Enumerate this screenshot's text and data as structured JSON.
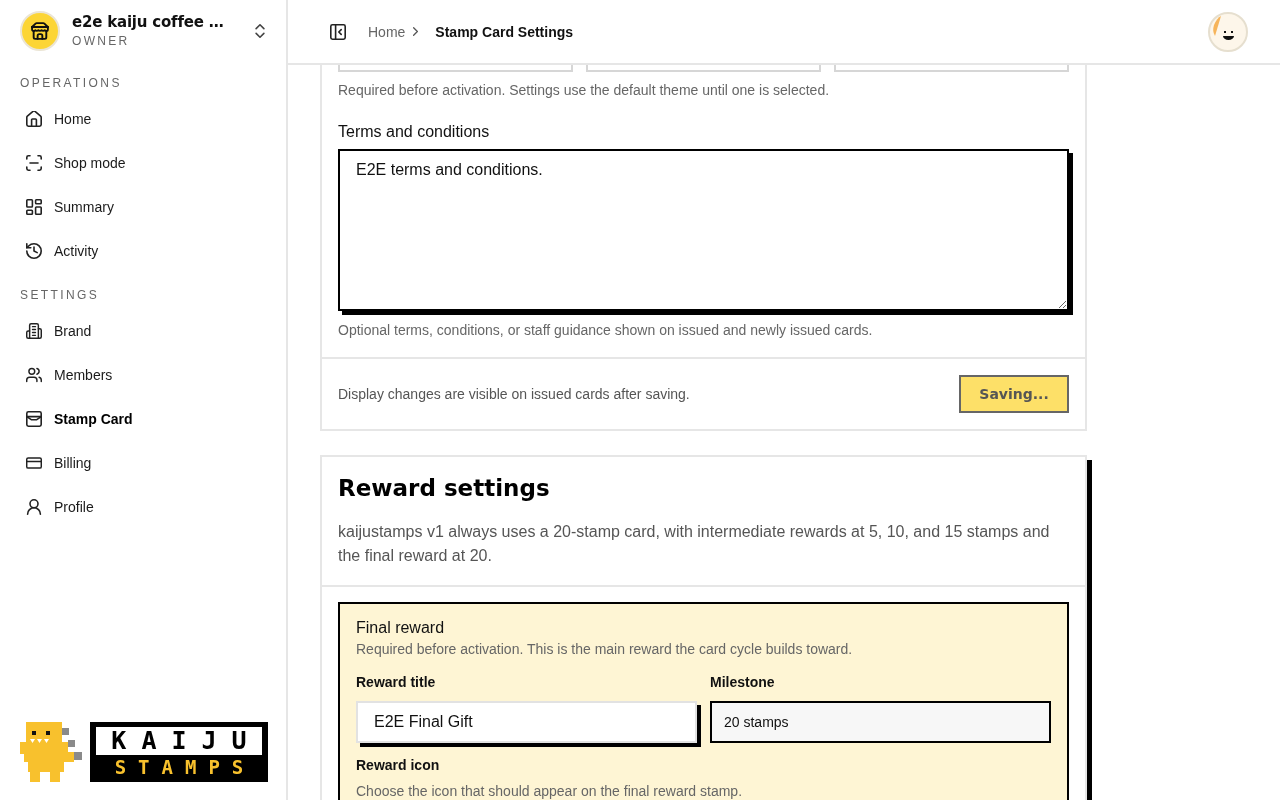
{
  "workspace": {
    "name": "e2e kaiju coffee …",
    "role": "OWNER"
  },
  "sidebar": {
    "sections": [
      {
        "title": "OPERATIONS",
        "items": [
          {
            "label": "Home",
            "selected": false
          },
          {
            "label": "Shop mode",
            "selected": false
          },
          {
            "label": "Summary",
            "selected": false
          },
          {
            "label": "Activity",
            "selected": false
          }
        ]
      },
      {
        "title": "SETTINGS",
        "items": [
          {
            "label": "Brand",
            "selected": false
          },
          {
            "label": "Members",
            "selected": false
          },
          {
            "label": "Stamp Card",
            "selected": true
          },
          {
            "label": "Billing",
            "selected": false
          },
          {
            "label": "Profile",
            "selected": false
          }
        ]
      }
    ],
    "logo": {
      "line_1": "KAIJU",
      "line_2": "STAMPS"
    }
  },
  "header": {
    "breadcrumbs": [
      {
        "label": "Home"
      },
      {
        "label": "Stamp Card Settings"
      }
    ]
  },
  "display_card": {
    "theme_options": [
      {
        "selected": false
      },
      {
        "selected": false
      },
      {
        "selected": false
      }
    ],
    "theme_hint": "Required before activation. Settings use the default theme until one is selected.",
    "terms": {
      "label": "Terms and conditions",
      "value": "E2E terms and conditions.",
      "hint": "Optional terms, conditions, or staff guidance shown on issued and newly issued cards."
    },
    "footer_note": "Display changes are visible on issued cards after saving.",
    "save_button": {
      "label": "Saving...",
      "disabled": true
    }
  },
  "reward_card": {
    "title": "Reward settings",
    "description": "kaijustamps v1 always uses a 20-stamp card, with intermediate rewards at 5, 10, and 15 stamps and the final reward at 20.",
    "final_reward": {
      "title": "Final reward",
      "subtitle": "Required before activation. This is the main reward the card cycle builds toward.",
      "fields": [
        {
          "label": "Reward title",
          "value": "E2E Final Gift",
          "disabled": false
        },
        {
          "label": "Milestone",
          "value": "20 stamps",
          "disabled": true
        }
      ],
      "icon_label": "Reward icon",
      "icon_hint": "Choose the icon that should appear on the final reward stamp."
    }
  }
}
